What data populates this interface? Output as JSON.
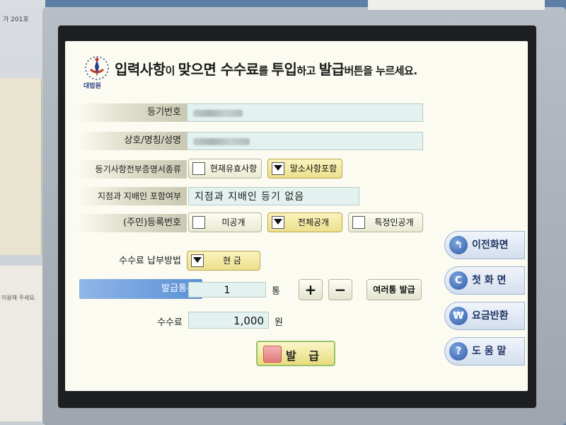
{
  "header": {
    "part1": "입력사항",
    "part2": "이 ",
    "part3": "맞으면 수수료",
    "part4": "를 ",
    "part5": "투입",
    "part6": "하고 ",
    "part7": "발급",
    "part8": "버튼을 누르세요.",
    "logo_caption": "대법원"
  },
  "wall": {
    "note": "가 201호",
    "note2": "이용해 주세요."
  },
  "form": {
    "reg_number_label": "등기번호",
    "name_label": "상호/명칭/성명",
    "cert_type_label": "등기사항전부증명서종류",
    "cert_type_options": [
      "현재유효사항",
      "말소사항포함"
    ],
    "branch_label": "지점과 지배인 포함여부",
    "branch_value": "지점과 지배인 등기 없음",
    "id_label": "(주민)등록번호",
    "id_options": [
      "미공개",
      "전체공개",
      "특정인공개"
    ],
    "fee_method_label": "수수료 납부방법",
    "fee_method_value": "현 금",
    "copies_label": "발급통수",
    "copies_value": "1",
    "copies_unit": "통",
    "plus": "+",
    "minus": "−",
    "multi_issue": "여러통 발급",
    "fee_label": "수수료",
    "fee_value": "1,000",
    "fee_unit": "원"
  },
  "issue_button": "발 급",
  "side": {
    "prev": "이전화면",
    "home": "첫 화 면",
    "refund": "요금반환",
    "help": "도 움 말"
  }
}
